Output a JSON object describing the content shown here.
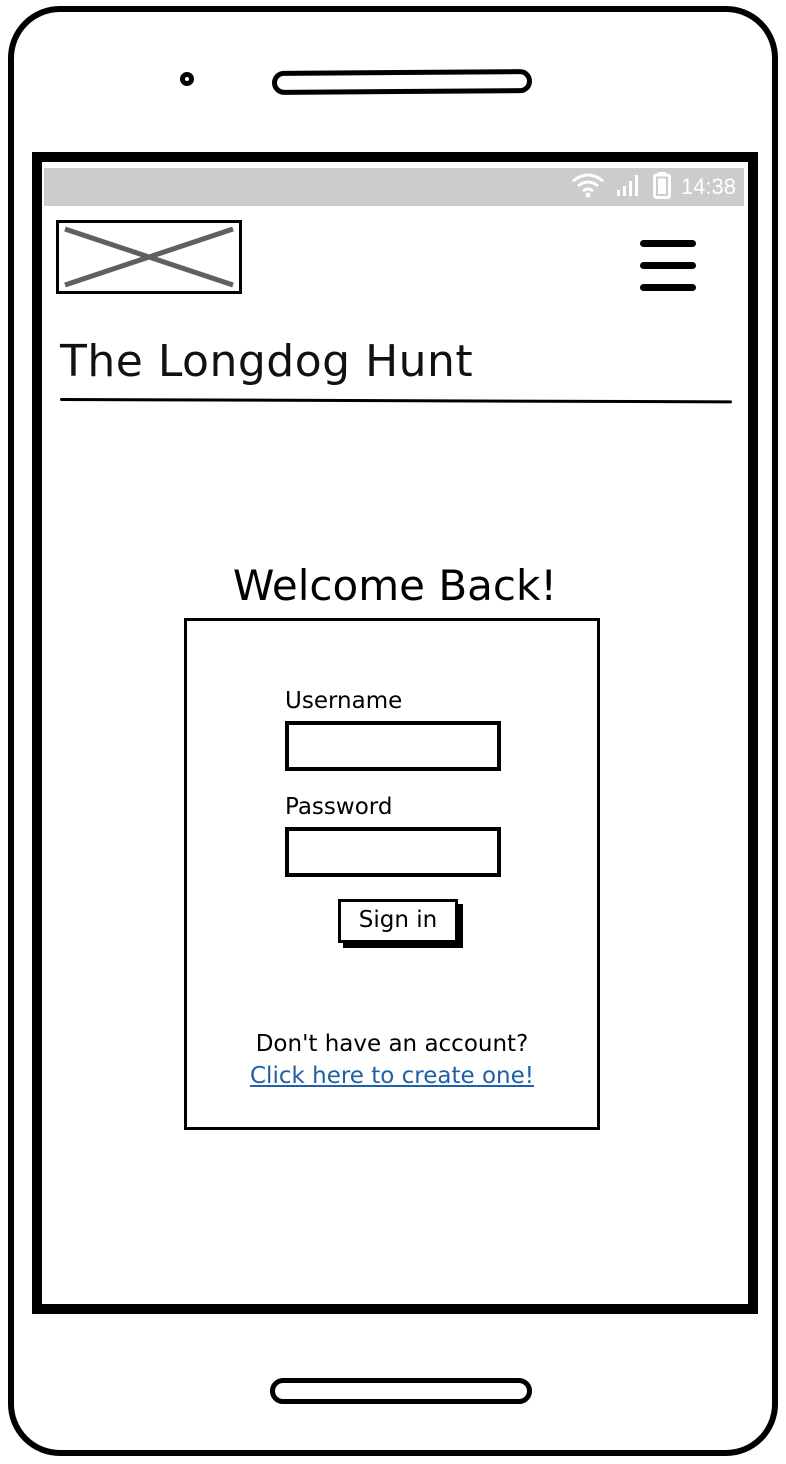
{
  "status_bar": {
    "time": "14:38",
    "icons": [
      "wifi-icon",
      "signal-icon",
      "battery-icon"
    ]
  },
  "header": {
    "logo": "image-placeholder-icon",
    "menu_icon": "hamburger-menu-icon",
    "app_title": "The Longdog Hunt"
  },
  "main": {
    "heading": "Welcome Back!",
    "form": {
      "username_label": "Username",
      "username_value": "",
      "password_label": "Password",
      "password_value": "",
      "submit_label": "Sign in",
      "signup_prompt": "Don't have an account?",
      "signup_link": "Click here to create one!"
    }
  },
  "colors": {
    "status_bar_bg": "#cccccc",
    "link": "#1f5fa8",
    "stroke": "#000000"
  }
}
